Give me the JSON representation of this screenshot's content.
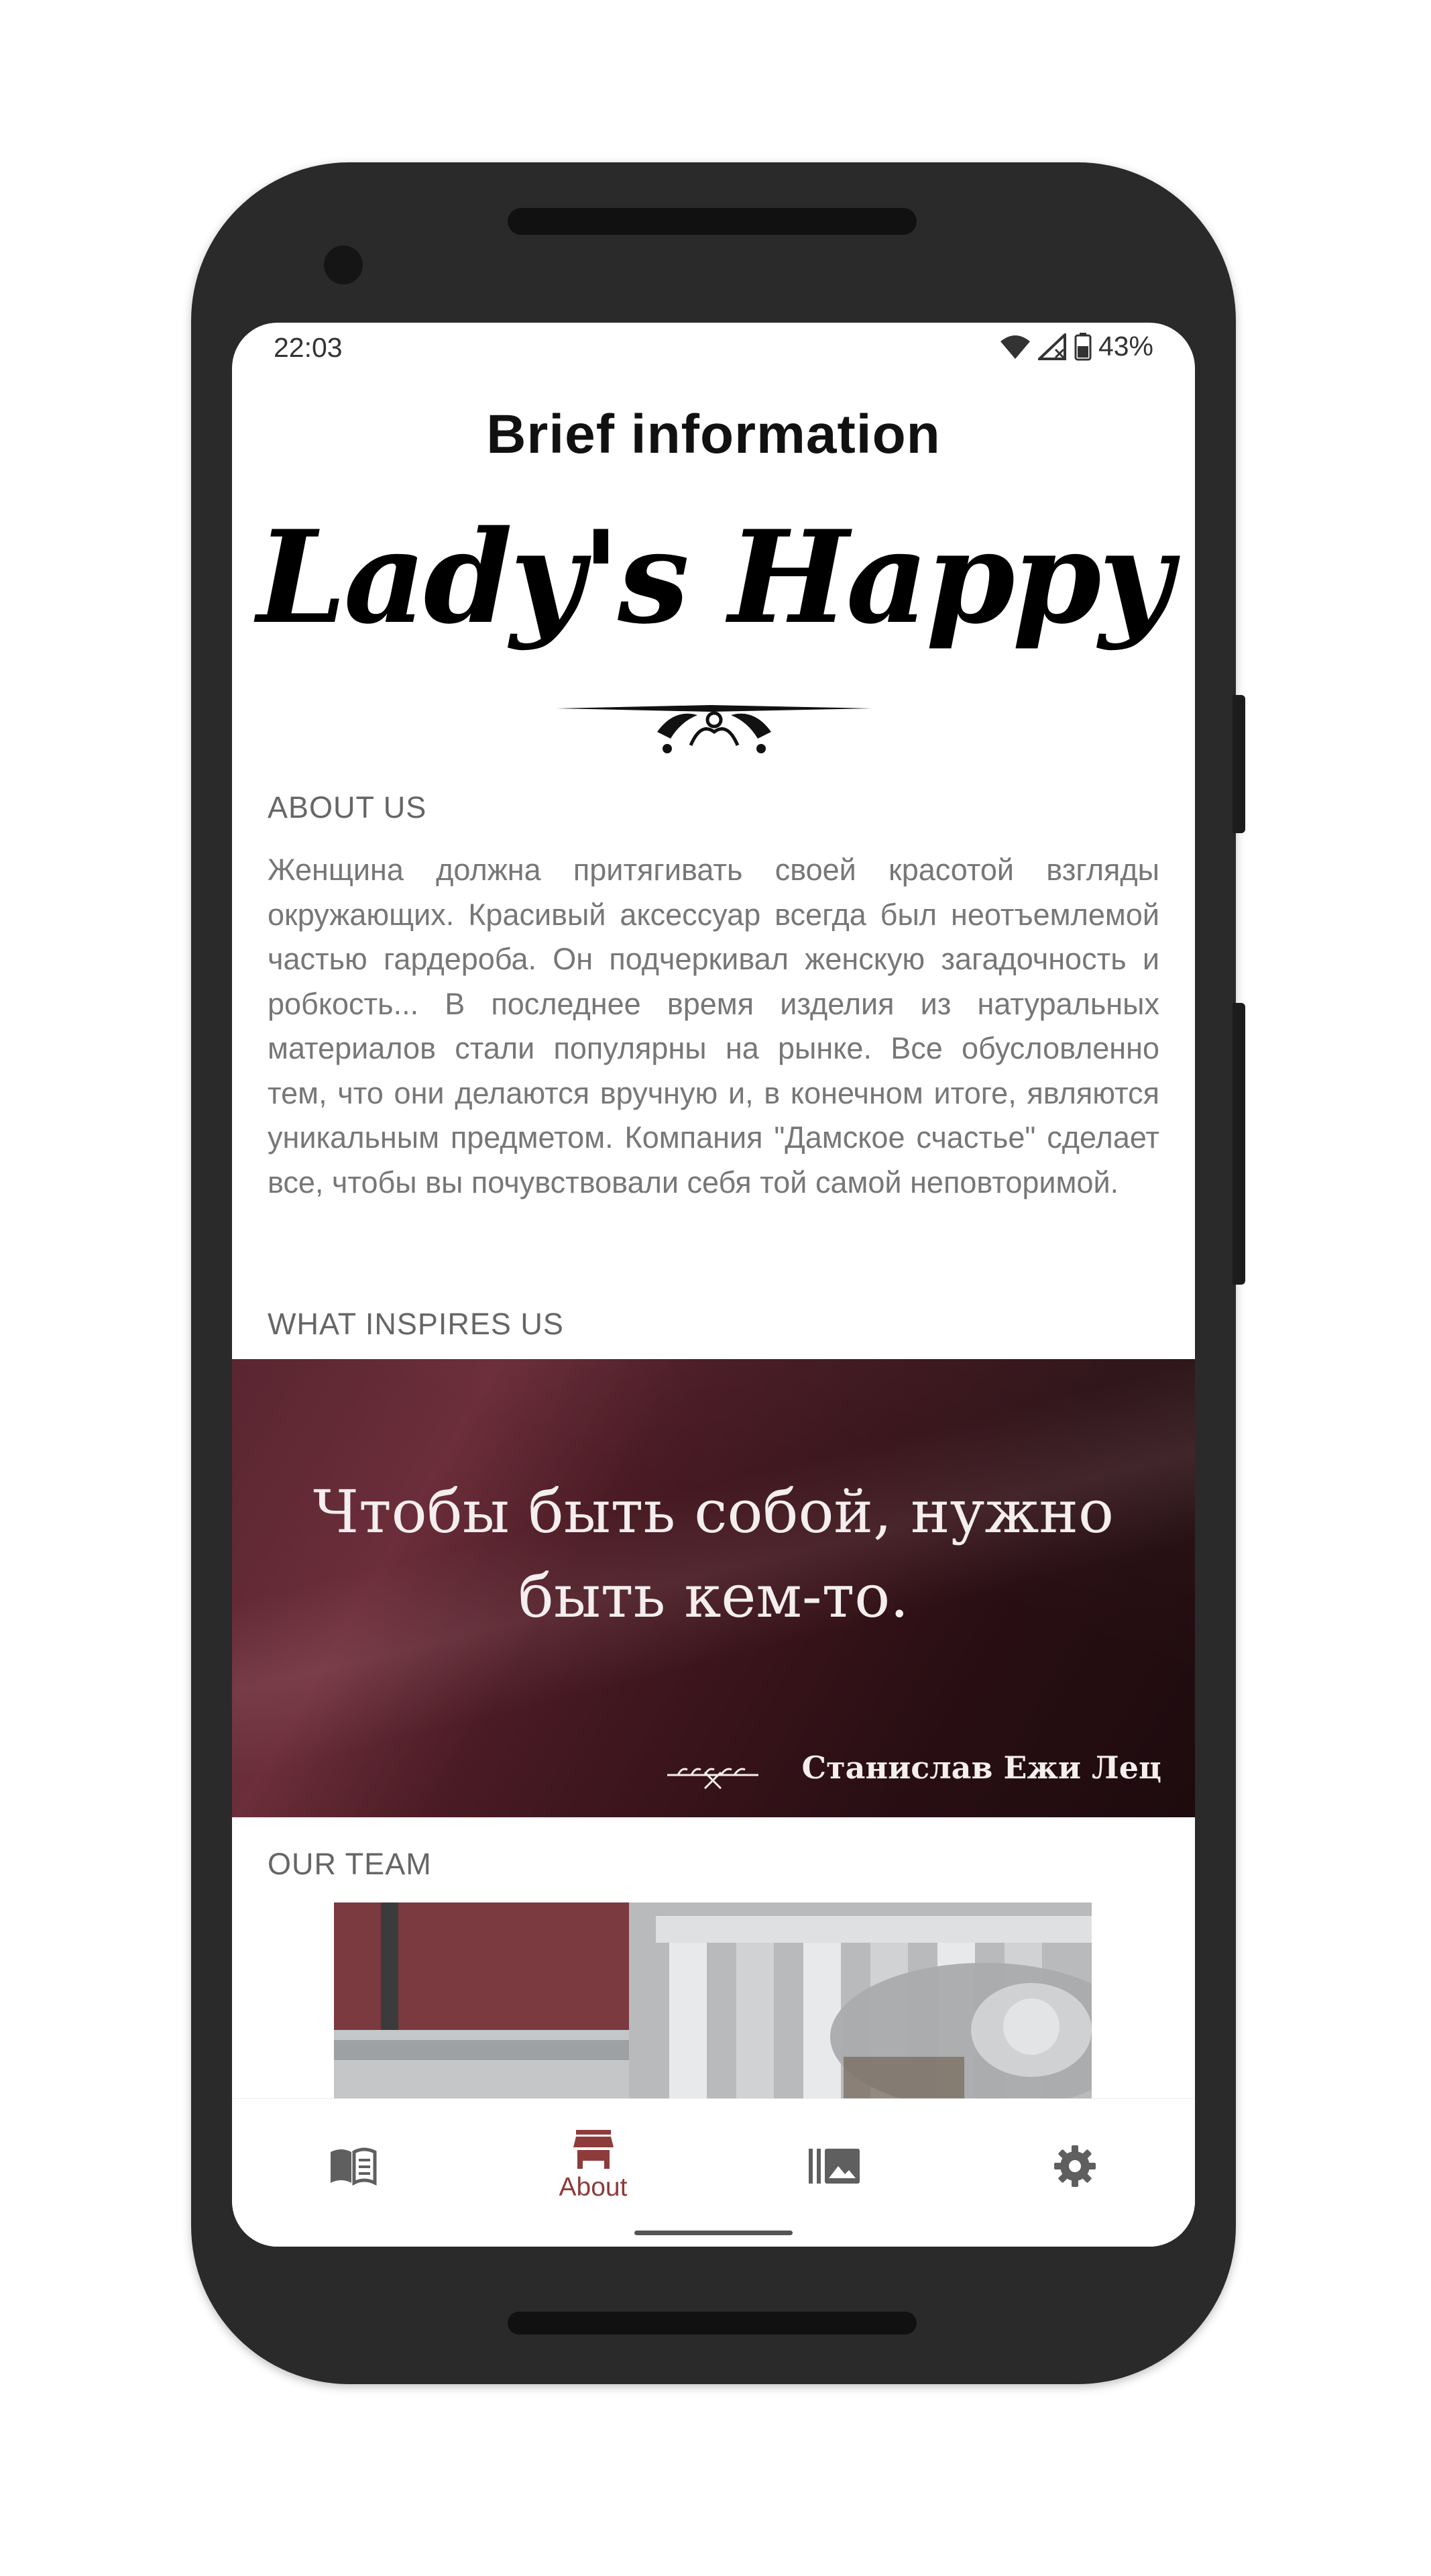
{
  "status_bar": {
    "time": "22:03",
    "battery": "43%",
    "icons": [
      "wifi-icon",
      "signal-icon",
      "battery-icon"
    ]
  },
  "header": {
    "title": "Brief information"
  },
  "logo": {
    "text": "Lady's Happy"
  },
  "about": {
    "label": "ABOUT US",
    "text": "Женщина должна притягивать своей красотой взгляды окружающих. Красивый аксессуар всегда был неотъемлемой частью гардероба. Он подчеркивал женскую загадочность и робкость...  В последнее время изделия из натуральных материалов стали популярны на рынке. Все обусловленно тем, что они делаются вручную и, в конечном итоге, являются уникальным предметом. Компания \"Дамское счастье\" сделает все, чтобы вы почувствовали себя той самой неповторимой."
  },
  "inspires": {
    "label": "WHAT INSPIRES US",
    "quote_line1": "Чтобы быть собой, нужно",
    "quote_line2": "быть кем-то.",
    "author": "Станислав Ежи Лец"
  },
  "team": {
    "label": "OUR TEAM"
  },
  "bottom_nav": {
    "items": [
      {
        "icon": "book-icon",
        "label": "",
        "active": false
      },
      {
        "icon": "store-icon",
        "label": "About",
        "active": true
      },
      {
        "icon": "gallery-icon",
        "label": "",
        "active": false
      },
      {
        "icon": "gear-icon",
        "label": "",
        "active": false
      }
    ]
  },
  "colors": {
    "accent": "#8e3b3b",
    "inactive_icon": "#5f5f5f",
    "phone_frame": "#2a2a2a"
  }
}
